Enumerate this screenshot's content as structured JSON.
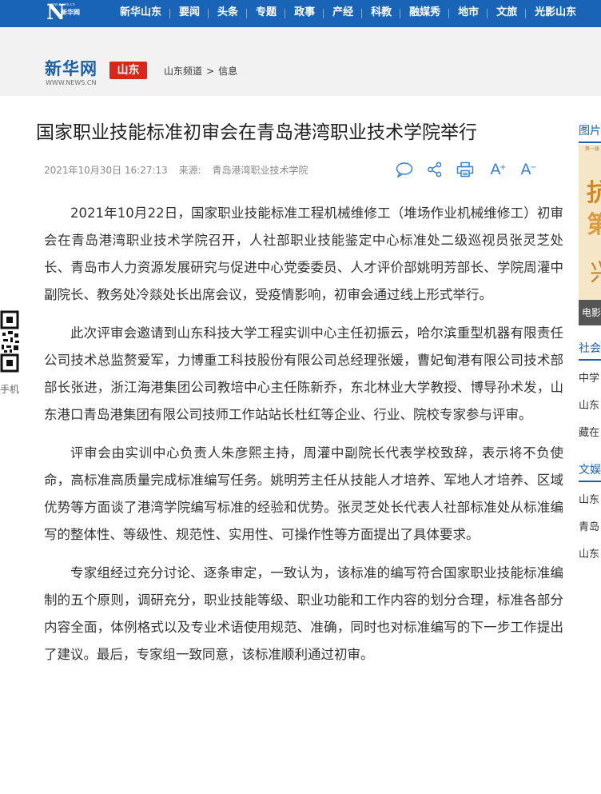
{
  "topnav": {
    "logo_letter": "N",
    "logo_sub": "新华网",
    "logo_url": "www.news.cn",
    "items": [
      "新华山东",
      "要闻",
      "头条",
      "专题",
      "政事",
      "产经",
      "科教",
      "融媒秀",
      "地市",
      "文旅",
      "光影山东"
    ]
  },
  "brand": {
    "name": "新华网",
    "url": "WWW.NEWS.CN",
    "tag": "山东"
  },
  "breadcrumb": {
    "channel": "山东频道",
    "separator": ">",
    "section": "信息"
  },
  "article": {
    "title": "国家职业技能标准初审会在青岛港湾职业技术学院举行",
    "datetime": "2021年10月30日 16:27:13",
    "source_label": "来源:",
    "source": "青岛港湾职业技术学院",
    "font_large": "A",
    "font_small": "A",
    "paragraphs": [
      "2021年10月22日，国家职业技能标准工程机械维修工（堆场作业机械维修工）初审会在青岛港湾职业技术学院召开，人社部职业技能鉴定中心标准处二级巡视员张灵芝处长、青岛市人力资源发展研究与促进中心党委委员、人才评价部姚明芳部长、学院周灌中副院长、教务处冷燚处长出席会议，受疫情影响，初审会通过线上形式举行。",
      "此次评审会邀请到山东科技大学工程实训中心主任初振云，哈尔滨重型机器有限责任公司技术总监赘爱军，力博重工科技股份有限公司总经理张媛，曹妃甸港有限公司技术部部长张进，浙江海港集团公司教培中心主任陈新乔，东北林业大学教授、博导孙术发，山东港口青岛港集团有限公司技师工作站站长杜红等企业、行业、院校专家参与评审。",
      "评审会由实训中心负责人朱彦熙主持，周灌中副院长代表学校致辞，表示将不负使命，高标准高质量完成标准编写任务。姚明芳主任从技能人才培养、军地人才培养、区域优势等方面谈了港湾学院编写标准的经验和优势。张灵芝处长代表人社部标准处从标准编写的整体性、等级性、规范性、实用性、可操作性等方面提出了具体要求。",
      "专家组经过充分讨论、逐条审定，一致认为，该标准的编写符合国家职业技能标准编制的五个原则，调研充分，职业技能等级、职业功能和工作内容的划分合理，标准各部分内容全面，体例格式以及专业术语使用规范、准确，同时也对标准编写的下一步工作提出了建议。最后，专家组一致同意，该标准顺利通过初审。"
    ]
  },
  "qr": {
    "label": "手机"
  },
  "sidebar": {
    "pictures_heading": "图片",
    "image_caption": "电影",
    "image_chars": [
      "抗",
      "第",
      "兴"
    ],
    "image_strip": "第一届",
    "society_heading": "社会",
    "society_links": [
      "中学",
      "山东",
      "藏在"
    ],
    "culture_heading": "文娱",
    "culture_links": [
      "山东",
      "青岛",
      "山东"
    ]
  },
  "colors": {
    "nav_bg": "#1a64b8",
    "brand_blue": "#1b5fa8",
    "brand_red": "#d8261c",
    "tool_blue": "#3b7fd0"
  },
  "icons": [
    "comment-icon",
    "share-icon",
    "print-icon",
    "font-larger-icon",
    "font-smaller-icon",
    "qr-code-icon"
  ]
}
